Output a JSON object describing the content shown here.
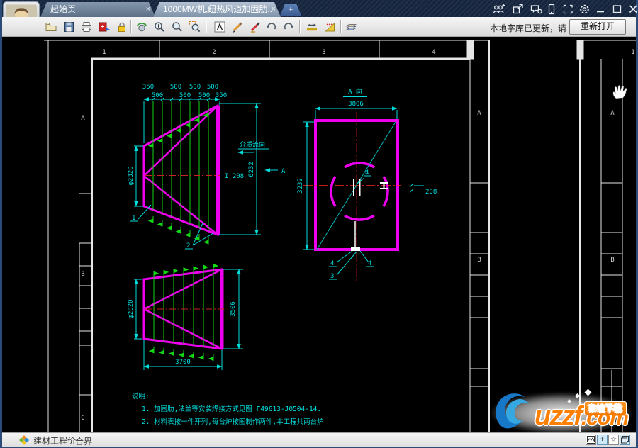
{
  "titlebar": {
    "tab1": "起始页",
    "tab2": "1000MW机,纽热风道加固肋..",
    "close_glyph": "×",
    "new_tab_glyph": "+"
  },
  "toolbar": {
    "notice": "本地字库已更新，请",
    "reopen": "重新打开"
  },
  "sheet": {
    "zone_cols": [
      "1",
      "2",
      "3",
      "4"
    ],
    "zone_rows": [
      "A",
      "B",
      "C"
    ],
    "right_rows": [
      "A",
      "B"
    ],
    "far_rows": [
      "A",
      "B"
    ],
    "far_col": "1"
  },
  "views": {
    "side": {
      "dims_row1": [
        "350",
        "500",
        "500",
        "500"
      ],
      "dims_row2": [
        "500",
        "500",
        "500",
        "350"
      ],
      "dia": "φ2320",
      "height": "6232",
      "beam": "I 208",
      "flow": "介质流向",
      "section": "A",
      "part1": "1",
      "part2": "2"
    },
    "front": {
      "title": "A 向",
      "width": "3806",
      "height": "3232",
      "offset": "208",
      "part4": "4",
      "part3": "3"
    },
    "bottom": {
      "dia": "φ2820",
      "height": "3506",
      "width": "3700"
    },
    "notes": {
      "title": "说明:",
      "line1": "1. 加固肋,法兰等安装焊接方式见图 Г49613-J0504-14.",
      "line2": "2. 材料表按一件开列,每台炉按图制作两件,本工程共两台炉"
    }
  },
  "statusbar": {
    "app_name": "建材工程价",
    "label": "合界",
    "cross_glyph": "+",
    "star_glyph": "☆"
  },
  "watermark": {
    "brand": "uzzf",
    "suffix": ".com",
    "badge": "东坡下载"
  }
}
